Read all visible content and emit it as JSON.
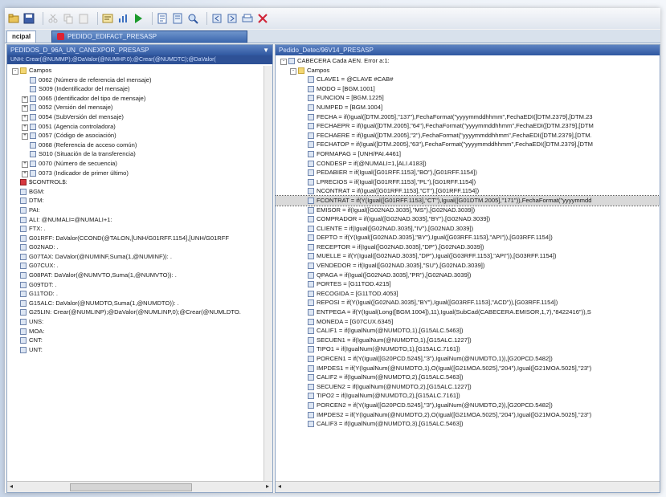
{
  "tabs": {
    "main": "ncipal",
    "doc": "PEDIDO_EDIFACT_PRESASP"
  },
  "left": {
    "title": "PEDIDOS_D_96A_UN_CANEXPOR_PRESASP",
    "subtitle": "UNH: Crear(@NUMMP);@DaValor(@NUMHP.0);@Crear(@NUMDTC);@DaValor(",
    "rows": [
      {
        "i": 0,
        "exp": "-",
        "icon": "folder",
        "text": "Campos"
      },
      {
        "i": 1,
        "exp": "",
        "icon": "field",
        "text": "0062 (Número de referencia del mensaje)"
      },
      {
        "i": 1,
        "exp": "",
        "icon": "field",
        "text": "S009 (Indentificador del mensaje)"
      },
      {
        "i": 1,
        "exp": "+",
        "icon": "field",
        "text": "0065 (Identificador del tipo de mensaje)"
      },
      {
        "i": 1,
        "exp": "+",
        "icon": "field",
        "text": "0052 (Versión del mensaje)"
      },
      {
        "i": 1,
        "exp": "+",
        "icon": "field",
        "text": "0054 (SubVersión del mensaje)"
      },
      {
        "i": 1,
        "exp": "+",
        "icon": "field",
        "text": "0051 (Agencia controladora)"
      },
      {
        "i": 1,
        "exp": "+",
        "icon": "field",
        "text": "0057 (Código de asociación)"
      },
      {
        "i": 1,
        "exp": "",
        "icon": "field",
        "text": "0068 (Referencia de acceso común)"
      },
      {
        "i": 1,
        "exp": "",
        "icon": "field",
        "text": "S010 (Situación de la transferencia)"
      },
      {
        "i": 1,
        "exp": "+",
        "icon": "field",
        "text": "0070 (Número de secuencia)"
      },
      {
        "i": 1,
        "exp": "+",
        "icon": "field",
        "text": "0073 (Indicador de primer último)"
      },
      {
        "i": 0,
        "exp": "",
        "icon": "red",
        "text": "$CONTROL$:"
      },
      {
        "i": 0,
        "exp": "",
        "icon": "field",
        "text": "BGM:"
      },
      {
        "i": 0,
        "exp": "",
        "icon": "field",
        "text": "DTM:"
      },
      {
        "i": 0,
        "exp": "",
        "icon": "field",
        "text": "PAI:"
      },
      {
        "i": 0,
        "exp": "",
        "icon": "field",
        "text": "ALI: @NUMALI=@NUMALI+1:"
      },
      {
        "i": 0,
        "exp": "",
        "icon": "field",
        "text": "FTX: ."
      },
      {
        "i": 0,
        "exp": "",
        "icon": "field",
        "text": "G01RFF: DaValor(CCOND(@TALON,[UNH/G01RFF.1154],[UNH/G01RFF"
      },
      {
        "i": 0,
        "exp": "",
        "icon": "field",
        "text": "G02NAD: ."
      },
      {
        "i": 0,
        "exp": "",
        "icon": "field",
        "text": "G07TAX: DaValor(@NUMINF,Suma(1,@NUMINF)): ."
      },
      {
        "i": 0,
        "exp": "",
        "icon": "field",
        "text": "G07CUX: ."
      },
      {
        "i": 0,
        "exp": "",
        "icon": "field",
        "text": "G08PAT: DaValor(@NUMVTO,Suma(1,@NUMVTO)): ."
      },
      {
        "i": 0,
        "exp": "",
        "icon": "field",
        "text": "G09TDT: ."
      },
      {
        "i": 0,
        "exp": "",
        "icon": "field",
        "text": "G11TOD: ."
      },
      {
        "i": 0,
        "exp": "",
        "icon": "field",
        "text": "G15ALC: DaValor(@NUMDTO,Suma(1,@NUMDTO)): ."
      },
      {
        "i": 0,
        "exp": "",
        "icon": "field",
        "text": "G25LIN: Crear(@NUMLINP);@DaValor(@NUMLINP,0);@Crear(@NUMLDTO."
      },
      {
        "i": 0,
        "exp": "",
        "icon": "field",
        "text": "UNS:"
      },
      {
        "i": 0,
        "exp": "",
        "icon": "field",
        "text": "MOA:"
      },
      {
        "i": 0,
        "exp": "",
        "icon": "field",
        "text": "CNT:"
      },
      {
        "i": 0,
        "exp": "",
        "icon": "field",
        "text": "UNT:"
      }
    ]
  },
  "right": {
    "title": "Pedido_Detec/96V14_PRESASP",
    "rows": [
      {
        "i": 0,
        "exp": "-",
        "icon": "field",
        "text": "CABECERA Cada AEN. Error a:1:"
      },
      {
        "i": 1,
        "exp": "-",
        "icon": "folder",
        "text": "Campos"
      },
      {
        "i": 2,
        "exp": "",
        "icon": "field",
        "text": "CLAVE1 = @CLAVE #CAB#"
      },
      {
        "i": 2,
        "exp": "",
        "icon": "field",
        "text": "MODO = [BGM.1001]"
      },
      {
        "i": 2,
        "exp": "",
        "icon": "field",
        "text": "FUNCION = [BGM.1225]"
      },
      {
        "i": 2,
        "exp": "",
        "icon": "field",
        "text": "NUMPED = [BGM.1004]"
      },
      {
        "i": 2,
        "exp": "",
        "icon": "field",
        "text": "FECHA = if(Igual([DTM.2005],\"137\"),FechaFormat(\"yyyymmddhhmm\",FechaEDI([DTM.2379],[DTM.23"
      },
      {
        "i": 2,
        "exp": "",
        "icon": "field",
        "text": "FECHAEPR = if(Igual([DTM.2005],\"64\"),FechaFormat(\"yyyymmddhhmm\",FechaEDI([DTM.2379],[DTM"
      },
      {
        "i": 2,
        "exp": "",
        "icon": "field",
        "text": "FECHAERE = if(Igual([DTM.2005],\"2\"),FechaFormat(\"yyyymmddhhmm\",FechaEDI([DTM.2379],[DTM."
      },
      {
        "i": 2,
        "exp": "",
        "icon": "field",
        "text": "FECHATOP = if(Igual([DTM.2005],\"63\"),FechaFormat(\"yyyymmddhhmm\",FechaEDI([DTM.2379],[DTM"
      },
      {
        "i": 2,
        "exp": "",
        "icon": "field",
        "text": "FORMAPAG = [UNH/PAI.4461]"
      },
      {
        "i": 2,
        "exp": "",
        "icon": "field",
        "text": "CONDESP = if(@NUMALI=1,[ALI.4183])"
      },
      {
        "i": 2,
        "exp": "",
        "icon": "field",
        "text": "PEDABIER = if(Igual([G01RFF.1153],\"BO\"),[G01RFF.1154])"
      },
      {
        "i": 2,
        "exp": "",
        "icon": "field",
        "text": "LPRECIOS = if(Igual([G01RFF.1153],\"PL\"),[G01RFF.1154])"
      },
      {
        "i": 2,
        "exp": "",
        "icon": "field",
        "text": "NCONTRAT = if(Igual([G01RFF.1153],\"CT\"),[G01RFF.1154])"
      },
      {
        "i": 2,
        "exp": "",
        "icon": "field",
        "text": "FCONTRAT = if(Y(Igual([G01RFF.1153],\"CT\"),Igual([G01DTM.2005],\"171\")),FechaFormat(\"yyyymmdd",
        "sel": true
      },
      {
        "i": 2,
        "exp": "",
        "icon": "field",
        "text": "EMISOR = if(Igual([G02NAD.3035],\"MS\"),[G02NAD.3039])"
      },
      {
        "i": 2,
        "exp": "",
        "icon": "field",
        "text": "COMPRADOR = if(Igual([G02NAD.3035],\"BY\"),[G02NAD.3039])"
      },
      {
        "i": 2,
        "exp": "",
        "icon": "field",
        "text": "CLIENTE = if(Igual([G02NAD.3035],\"IV\"),[G02NAD.3039])"
      },
      {
        "i": 2,
        "exp": "",
        "icon": "field",
        "text": "DEPTO = if(Y(Igual([G02NAD.3035],\"BY\"),Igual([G03RFF.1153],\"API\")),[G03RFF.1154])"
      },
      {
        "i": 2,
        "exp": "",
        "icon": "field",
        "text": "RECEPTOR = if(Igual([G02NAD.3035],\"DP\"),[G02NAD.3039])"
      },
      {
        "i": 2,
        "exp": "",
        "icon": "field",
        "text": "MUELLE = if(Y(Igual([G02NAD.3035],\"DP\"),Igual([G03RFF.1153],\"API\")),[G03RFF.1154])"
      },
      {
        "i": 2,
        "exp": "",
        "icon": "field",
        "text": "VENDEDOR = if(Igual([G02NAD.3035],\"SU\"),[G02NAD.3039])"
      },
      {
        "i": 2,
        "exp": "",
        "icon": "field",
        "text": "QPAGA = if(Igual([G02NAD.3035],\"PR\"),[G02NAD.3039])"
      },
      {
        "i": 2,
        "exp": "",
        "icon": "field",
        "text": "PORTES = [G11TOD.4215]"
      },
      {
        "i": 2,
        "exp": "",
        "icon": "field",
        "text": "RECOGIDA = [G11TOD.4053]"
      },
      {
        "i": 2,
        "exp": "",
        "icon": "field",
        "text": "REPOSI = if(Y(Igual([G02NAD.3035],\"BY\"),Igual([G03RFF.1153],\"ACD\")),[G03RFF.1154])"
      },
      {
        "i": 2,
        "exp": "",
        "icon": "field",
        "text": "ENTPEGA = if(Y(Igual(Long([BGM.1004]),11),Igual(SubCad(CABECERA.EMISOR,1,7),\"8422416\")),S"
      },
      {
        "i": 2,
        "exp": "",
        "icon": "field",
        "text": "MONEDA = [G07CUX.6345]"
      },
      {
        "i": 2,
        "exp": "",
        "icon": "field",
        "text": "CALIF1 = if(IgualNum(@NUMDTO,1),[G15ALC.5463])"
      },
      {
        "i": 2,
        "exp": "",
        "icon": "field",
        "text": "SECUEN1 = if(IgualNum(@NUMDTO,1),[G15ALC.1227])"
      },
      {
        "i": 2,
        "exp": "",
        "icon": "field",
        "text": "TIPO1 = if(IgualNum(@NUMDTO,1),[G15ALC.7161])"
      },
      {
        "i": 2,
        "exp": "",
        "icon": "field",
        "text": "PORCEN1 = if(Y(Igual([G20PCD.5245],\"3\"),IgualNum(@NUMDTO,1)),[G20PCD.5482])"
      },
      {
        "i": 2,
        "exp": "",
        "icon": "field",
        "text": "IMPDES1 = if(Y(IgualNum(@NUMDTO,1),O(Igual([G21MOA.5025],\"204\"),Igual([G21MOA.5025],\"23\")"
      },
      {
        "i": 2,
        "exp": "",
        "icon": "field",
        "text": "CALIF2 = if(IgualNum(@NUMDTO,2),[G15ALC.5463])"
      },
      {
        "i": 2,
        "exp": "",
        "icon": "field",
        "text": "SECUEN2 = if(IgualNum(@NUMDTO,2),[G15ALC.1227])"
      },
      {
        "i": 2,
        "exp": "",
        "icon": "field",
        "text": "TIPO2 = if(IgualNum(@NUMDTO,2),[G15ALC.7161])"
      },
      {
        "i": 2,
        "exp": "",
        "icon": "field",
        "text": "PORCEN2 = if(Y(Igual([G20PCD.5245],\"3\"),IgualNum(@NUMDTO,2)),[G20PCD.5482])"
      },
      {
        "i": 2,
        "exp": "",
        "icon": "field",
        "text": "IMPDES2 = if(Y(IgualNum(@NUMDTO,2),O(Igual([G21MOA.5025],\"204\"),Igual([G21MOA.5025],\"23\")"
      },
      {
        "i": 2,
        "exp": "",
        "icon": "field",
        "text": "CALIF3 = if(IgualNum(@NUMDTO,3),[G15ALC.5463])"
      }
    ]
  },
  "colors": {
    "accent": "#2f57a0",
    "frame": "#3a78c8",
    "selection": "#d9d9d9"
  }
}
